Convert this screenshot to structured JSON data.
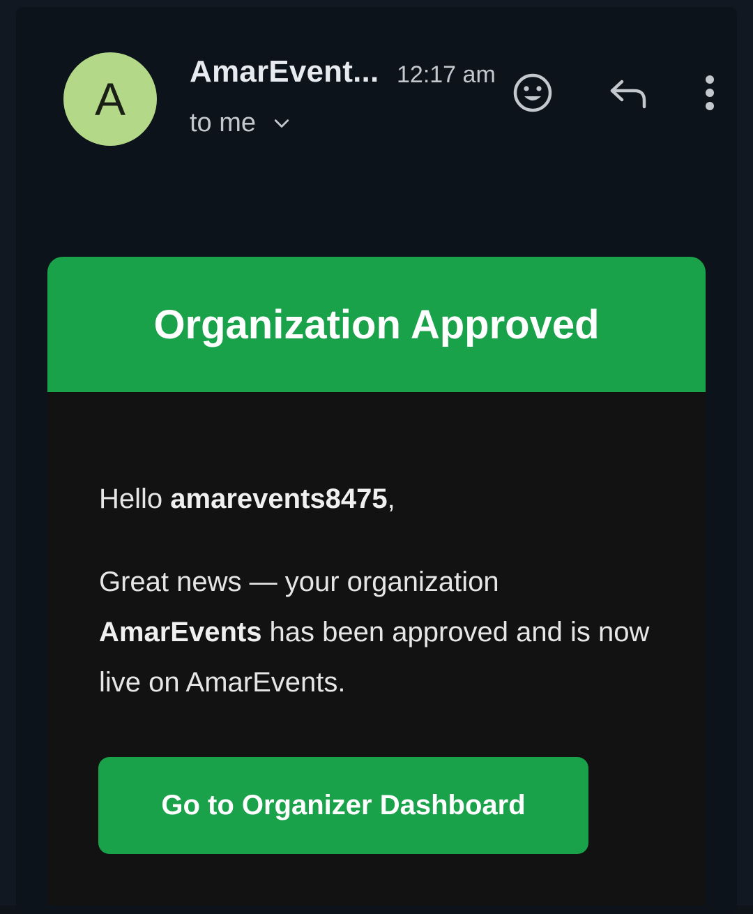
{
  "header": {
    "avatar_letter": "A",
    "sender_name": "AmarEvent...",
    "time": "12:17 am",
    "recipient": "to me",
    "icons": {
      "recipient_toggle": "chevron-down-icon",
      "emoji": "emoji-reaction-icon",
      "reply": "reply-icon",
      "more": "more-vert-icon"
    }
  },
  "email": {
    "banner_title": "Organization Approved",
    "greeting_prefix": "Hello ",
    "greeting_username": "amarevents8475",
    "greeting_suffix": ",",
    "message_part1": "Great news — your organization ",
    "message_org": "AmarEvents",
    "message_part2": " has been approved and is now live on AmarEvents.",
    "cta_label": "Go to Organizer Dashboard"
  },
  "colors": {
    "background": "#0d131a",
    "avatar": "#b3d888",
    "accent_green": "#1aa24b",
    "body_bg": "#121212"
  }
}
